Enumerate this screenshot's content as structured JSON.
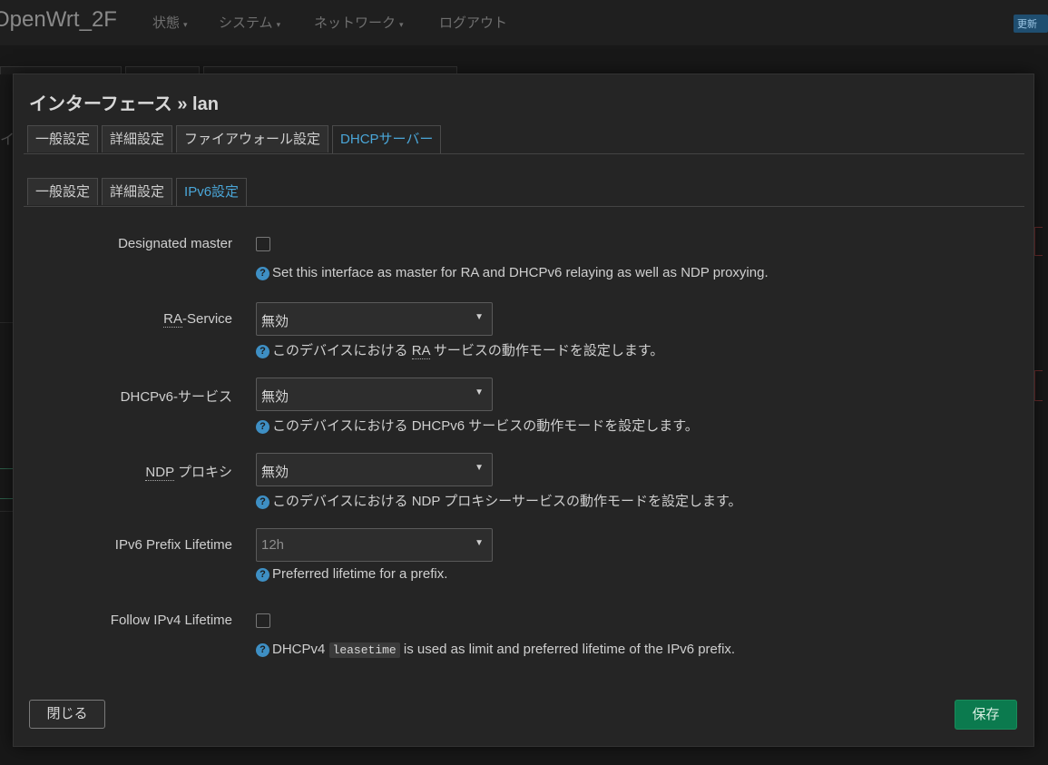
{
  "header": {
    "brand": "OpenWrt_2F",
    "nav": [
      {
        "label": "状態",
        "caret": "▾"
      },
      {
        "label": "システム",
        "caret": "▾"
      },
      {
        "label": "ネットワーク",
        "caret": "▾"
      },
      {
        "label": "ログアウト",
        "caret": ""
      }
    ],
    "update_badge": "更新"
  },
  "modal": {
    "title": "インターフェース » lan",
    "main_tabs": [
      "一般設定",
      "詳細設定",
      "ファイアウォール設定",
      "DHCPサーバー"
    ],
    "main_tabs_active": "DHCPサーバー",
    "sub_tabs": [
      "一般設定",
      "詳細設定",
      "IPv6設定"
    ],
    "sub_tabs_active": "IPv6設定",
    "help_icon": "?",
    "fields": {
      "designated_master": {
        "label": "Designated master",
        "checked": false,
        "help": "Set this interface as master for RA and DHCPv6 relaying as well as NDP proxying."
      },
      "ra_service": {
        "label_abbr": "RA",
        "label_rest": "-Service",
        "value": "無効",
        "help_before": "このデバイスにおける ",
        "help_abbr": "RA",
        "help_after": " サービスの動作モードを設定します。"
      },
      "dhcpv6_service": {
        "label": "DHCPv6-サービス",
        "value": "無効",
        "help": "このデバイスにおける DHCPv6 サービスの動作モードを設定します。"
      },
      "ndp_proxy": {
        "label_abbr": "NDP",
        "label_rest": " プロキシ",
        "value": "無効",
        "help": "このデバイスにおける NDP プロキシーサービスの動作モードを設定します。"
      },
      "ipv6_prefix_lifetime": {
        "label": "IPv6 Prefix Lifetime",
        "placeholder": "12h",
        "help": "Preferred lifetime for a prefix."
      },
      "follow_ipv4_lifetime": {
        "label": "Follow IPv4 Lifetime",
        "checked": false,
        "help_before": "DHCPv4 ",
        "help_code": "leasetime",
        "help_after": " is used as limit and preferred lifetime of the IPv6 prefix."
      }
    },
    "buttons": {
      "close": "閉じる",
      "save": "保存"
    }
  },
  "colors": {
    "accent": "#4aa6d8",
    "save_button": "#0b7a4e",
    "help_icon": "#3e8fc4"
  }
}
